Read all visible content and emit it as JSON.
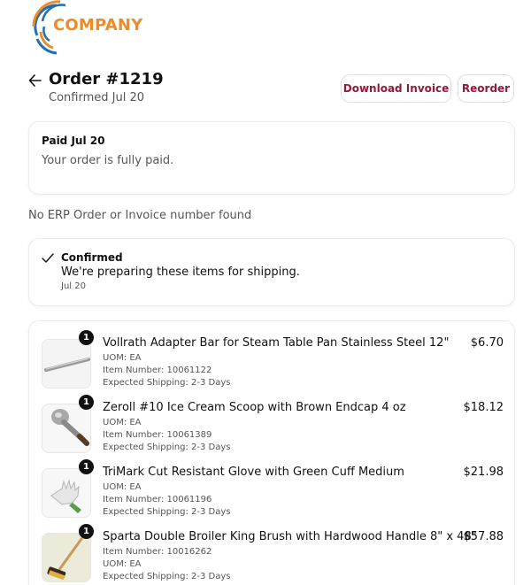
{
  "logo": {
    "text": "COMPANY"
  },
  "header": {
    "title": "Order #1219",
    "subtitle": "Confirmed Jul 20",
    "download_label": "Download Invoice",
    "reorder_label": "Reorder"
  },
  "payment": {
    "title": "Paid Jul 20",
    "text": "Your order is fully paid."
  },
  "erp_note": "No ERP Order or Invoice number found",
  "status": {
    "title": "Confirmed",
    "text": "We're preparing these items for shipping.",
    "date": "Jul 20"
  },
  "items": [
    {
      "qty": "1",
      "name": "Vollrath Adapter Bar for Steam Table Pan Stainless Steel 12\"",
      "price": "$6.70",
      "line1": "UOM: EA",
      "line2": "Item Number: 10061122",
      "line3": "Expected Shipping: 2-3 Days",
      "thumb_icon": "adapter-bar-image"
    },
    {
      "qty": "1",
      "name": "Zeroll #10 Ice Cream Scoop with Brown Endcap 4 oz",
      "price": "$18.12",
      "line1": "UOM: EA",
      "line2": "Item Number: 10061389",
      "line3": "Expected Shipping: 2-3 Days",
      "thumb_icon": "ice-cream-scoop-image"
    },
    {
      "qty": "1",
      "name": "TriMark Cut Resistant Glove with Green Cuff Medium",
      "price": "$21.98",
      "line1": "UOM: EA",
      "line2": "Item Number: 10061196",
      "line3": "Expected Shipping: 2-3 Days",
      "thumb_icon": "glove-image"
    },
    {
      "qty": "1",
      "name": "Sparta Double Broiler King Brush with Hardwood Handle 8\" x 48\"",
      "price": "$57.88",
      "line1": "Item Number: 10016262",
      "line2": "UOM: EA",
      "line3": "Expected Shipping: 2-3 Days",
      "thumb_icon": "broiler-brush-image"
    }
  ],
  "colors": {
    "accent": "#8f1d3a",
    "logo_orange": "#f08a24",
    "logo_blue": "#1f6fb5"
  }
}
